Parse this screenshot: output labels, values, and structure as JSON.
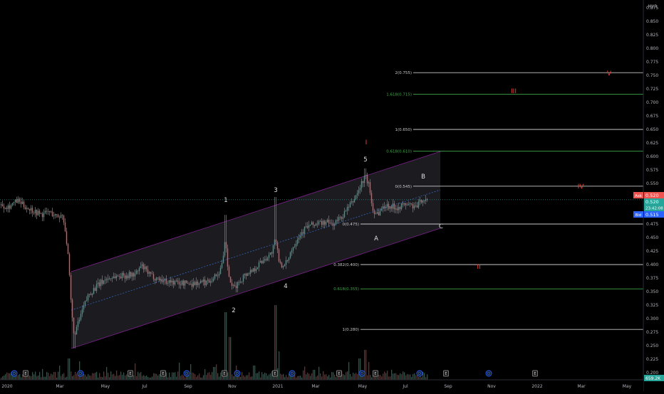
{
  "currency": "MYR",
  "price_axis": {
    "ticks": [
      "0.875",
      "0.850",
      "0.825",
      "0.800",
      "0.775",
      "0.750",
      "0.725",
      "0.700",
      "0.675",
      "0.650",
      "0.625",
      "0.600",
      "0.575",
      "0.550",
      "0.525",
      "0.500",
      "0.475",
      "0.450",
      "0.425",
      "0.400",
      "0.375",
      "0.350",
      "0.325",
      "0.300",
      "0.275",
      "0.250",
      "0.225",
      "0.200"
    ]
  },
  "time_axis": {
    "labels": [
      "2020",
      "Mar",
      "May",
      "Jul",
      "Sep",
      "Nov",
      "2021",
      "Mar",
      "May",
      "Jul",
      "Sep",
      "Nov",
      "2022",
      "Mar",
      "May"
    ]
  },
  "quote": {
    "ask_tag": "Ask",
    "ask": "0.520",
    "last": "0.520",
    "countdown": "23:42:08",
    "bid_tag": "Bid",
    "bid": "0.515",
    "volume": "659.2K"
  },
  "fib_levels": [
    {
      "label": "2(0.755)",
      "price": 0.755,
      "color": "#c8c8c8"
    },
    {
      "label": "1.618(0.715)",
      "price": 0.715,
      "color": "#3fa548"
    },
    {
      "label": "1(0.650)",
      "price": 0.65,
      "color": "#c8c8c8"
    },
    {
      "label": "0.618(0.610)",
      "price": 0.61,
      "color": "#3fa548"
    },
    {
      "label": "0(0.545)",
      "price": 0.545,
      "color": "#c8c8c8"
    },
    {
      "label": "0(0.475)",
      "price": 0.475,
      "color": "#c8c8c8"
    },
    {
      "label": "0.382(0.400)",
      "price": 0.4,
      "color": "#c8c8c8"
    },
    {
      "label": "0.618(0.355)",
      "price": 0.355,
      "color": "#3fa548"
    },
    {
      "label": "1(0.280)",
      "price": 0.28,
      "color": "#c8c8c8"
    }
  ],
  "wave_labels_white": [
    "1",
    "2",
    "3",
    "4",
    "5",
    "A",
    "B",
    "C"
  ],
  "wave_labels_red": [
    "I",
    "II",
    "III",
    "IV",
    "V"
  ],
  "event_markers": [
    "D",
    "E",
    "D",
    "E",
    "E",
    "D",
    "E",
    "D",
    "E",
    "D",
    "E",
    "D",
    "E",
    "D",
    "E",
    "D",
    "E"
  ],
  "colors": {
    "up": "#26a69a",
    "down": "#ef5350",
    "channel": "#9c27b0",
    "fib_green": "#3fa548",
    "wave_red": "#f44336",
    "ask": "#ef5350",
    "bid": "#2962ff",
    "last": "#26a69a"
  },
  "icons": {
    "dividend": "circle-d-icon",
    "earnings": "square-e-icon"
  }
}
